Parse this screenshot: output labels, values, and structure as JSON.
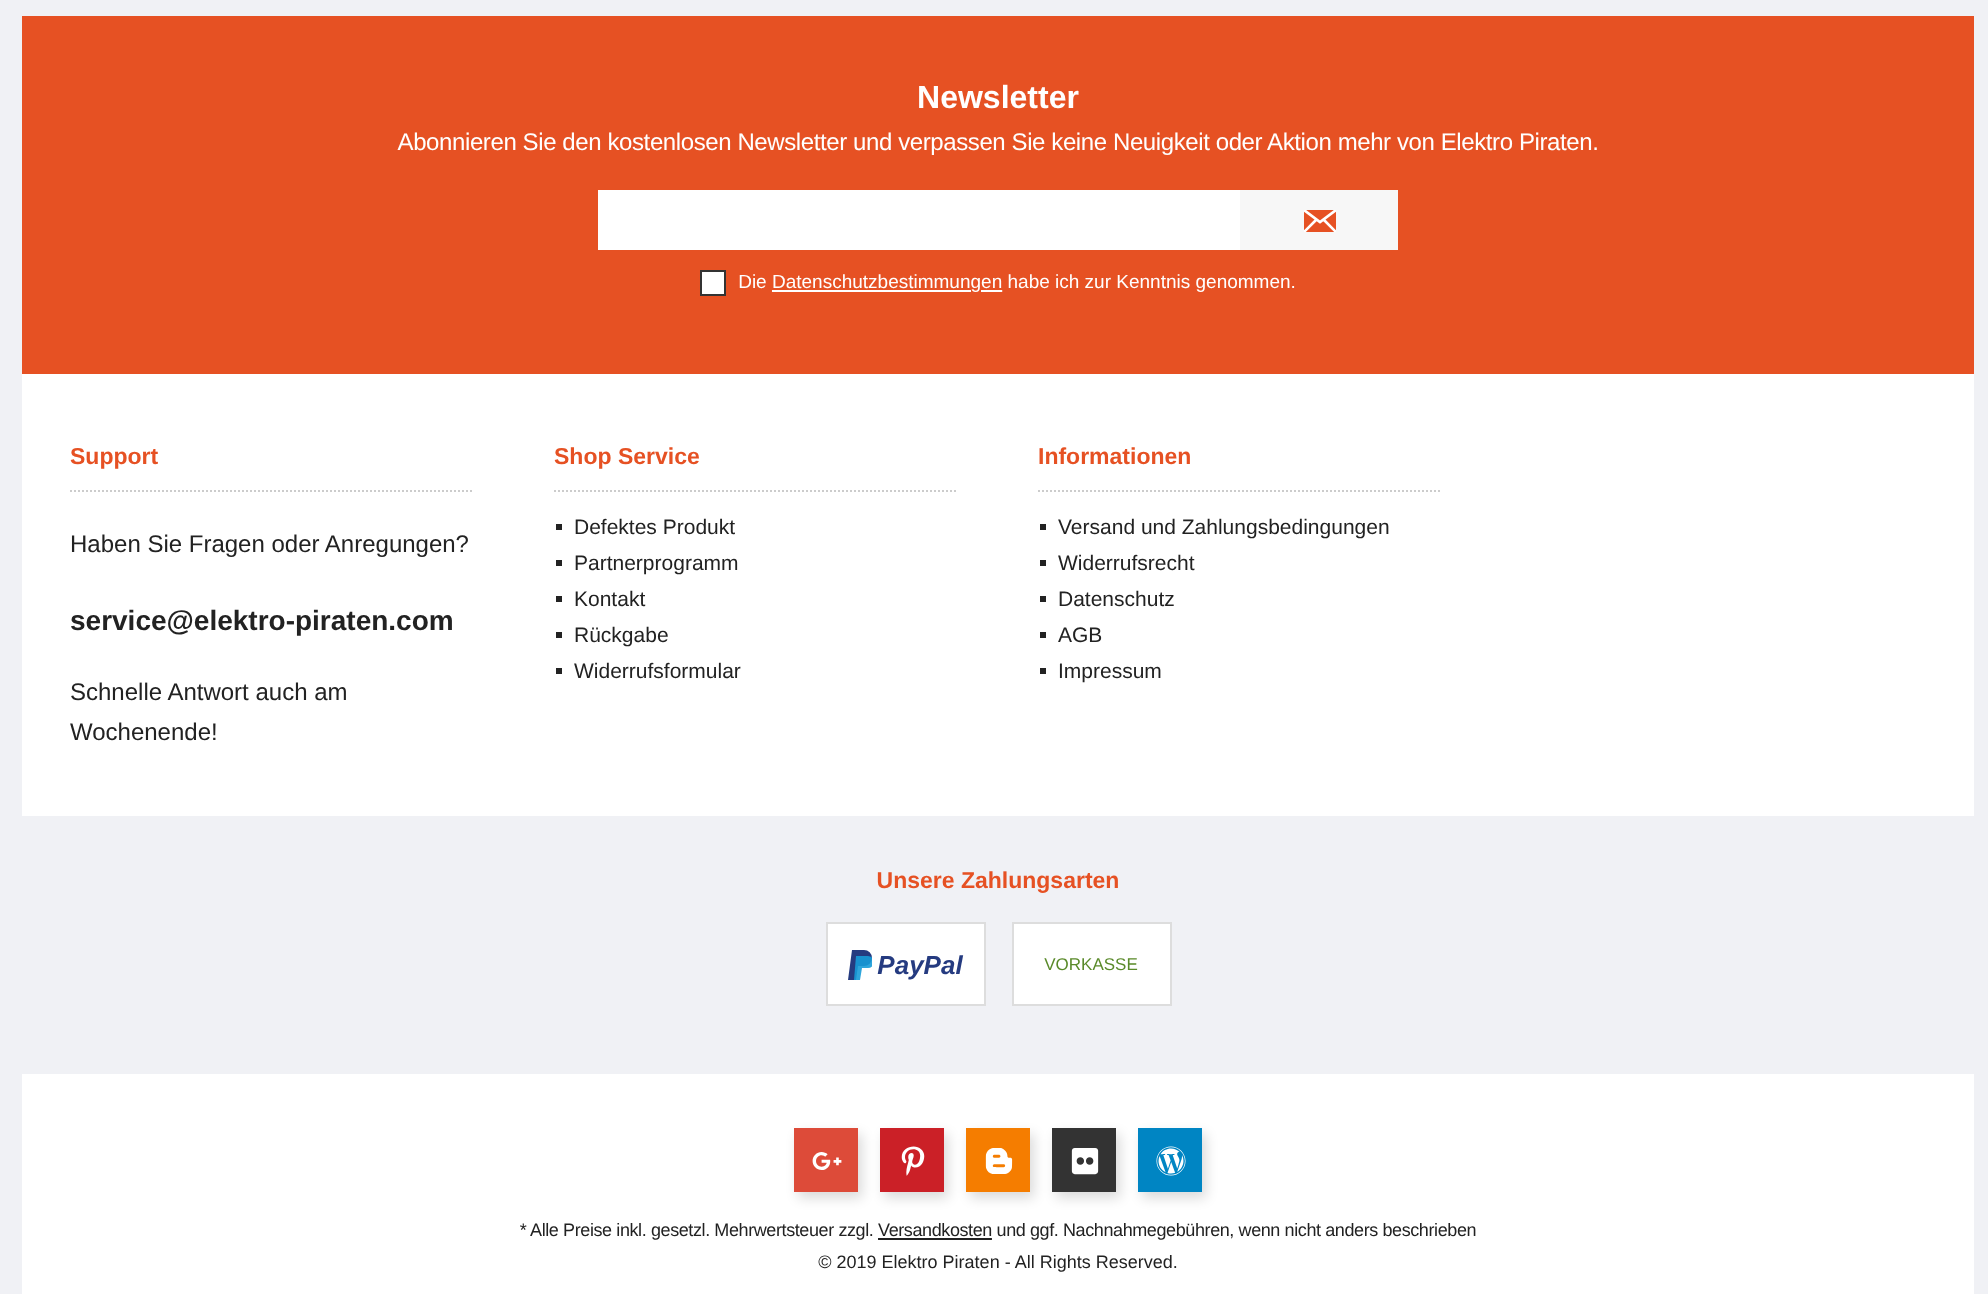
{
  "newsletter": {
    "title": "Newsletter",
    "subtitle": "Abonnieren Sie den kostenlosen Newsletter und verpassen Sie keine Neuigkeit oder Aktion mehr von Elektro Piraten.",
    "consent": {
      "checked": false,
      "before": "Die",
      "link": "Datenschutzbestimmungen",
      "after": "habe ich zur Kenntnis genommen."
    }
  },
  "columns": [
    {
      "title": "Support",
      "kind": "text",
      "lines": [
        {
          "text": "Haben Sie Fragen oder Anregungen?",
          "bold": false
        },
        {
          "text": "service@elektro-piraten.com",
          "bold": true
        },
        {
          "text": "Schnelle Antwort auch am Wochenende!",
          "bold": false
        }
      ]
    },
    {
      "title": "Shop Service",
      "kind": "list",
      "items": [
        "Defektes Produkt",
        "Partnerprogramm",
        "Kontakt",
        "Rückgabe",
        "Widerrufsformular"
      ]
    },
    {
      "title": "Informationen",
      "kind": "list",
      "items": [
        "Versand und Zahlungsbedingungen",
        "Widerrufsrecht",
        "Datenschutz",
        "AGB",
        "Impressum"
      ]
    }
  ],
  "payments": {
    "title": "Unsere Zahlungsarten",
    "methods": [
      {
        "kind": "paypal",
        "label": "PayPal"
      },
      {
        "kind": "vorkasse",
        "label": "VORKASSE"
      }
    ]
  },
  "social": [
    {
      "kind": "googleplus",
      "color": "#dd4b39"
    },
    {
      "kind": "pinterest",
      "color": "#cb2027"
    },
    {
      "kind": "blogger",
      "color": "#f57d00"
    },
    {
      "kind": "flickr",
      "color": "#333333"
    },
    {
      "kind": "wordpress",
      "color": "#0085c3"
    }
  ],
  "legal": {
    "before": "* Alle Preise inkl. gesetzl. Mehrwertsteuer zzgl.",
    "link": "Versandkosten",
    "after": "und ggf. Nachnahmegebühren, wenn nicht anders beschrieben",
    "copyright": "© 2019 Elektro Piraten - All Rights Reserved."
  }
}
